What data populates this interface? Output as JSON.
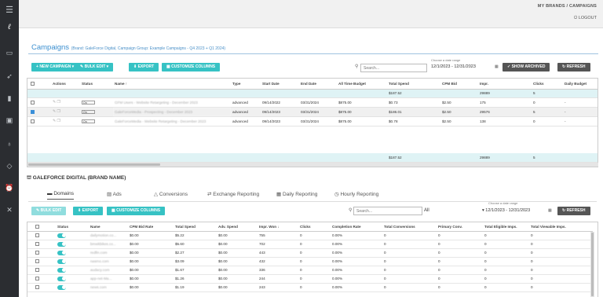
{
  "header": {
    "breadcrumb": "MY BRANDS / CAMPAIGNS",
    "logout": "LOGOUT"
  },
  "sidebar": {
    "icons": [
      "menu-icon",
      "logo-icon",
      "monitor-icon",
      "rocket-icon",
      "chart-icon",
      "briefcase-icon",
      "lightbulb-icon",
      "gem-icon",
      "alarm-icon",
      "tools-icon"
    ]
  },
  "campaigns": {
    "title": "Campaigns",
    "subtitle": "(Brand: GaleForce Digital, Campaign Group: Example Campaigns - Q4 2023 + Q1 2024)",
    "new_campaign": "NEW CAMPAIGN",
    "bulk_edit": "BULK EDIT",
    "export": "EXPORT",
    "customize": "CUSTOMIZE COLUMNS",
    "search_placeholder": "Search...",
    "date_label": "Choose a date range",
    "date_range": "12/1/2023 - 12/31/2023",
    "show_archived": "SHOW ARCHIVED",
    "refresh": "REFRESH",
    "columns": [
      "Actions",
      "Status",
      "Name ↑",
      "Type",
      "Start Date",
      "End Date",
      "All Time Budget",
      "Total Spend",
      "CPM Bid",
      "Impr.",
      "Clicks",
      "Daily Budget"
    ],
    "totals": {
      "spend": "$187.52",
      "impr": "29889",
      "clicks": "5"
    },
    "rows": [
      {
        "status": "On",
        "name": "GFM Users - Website Retargeting - December 2023",
        "type": "advanced",
        "start": "09/14/2022",
        "end": "03/31/2024",
        "budget": "$875.00",
        "spend": "$0.73",
        "cpm": "$2.50",
        "impr": "175",
        "clicks": "0",
        "daily": "-"
      },
      {
        "status": "On",
        "name": "GaleForceMedia - Prospecting - December 2023",
        "type": "advanced",
        "start": "09/14/2023",
        "end": "03/31/2024",
        "budget": "$875.00",
        "spend": "$186.01",
        "cpm": "$2.50",
        "impr": "29576",
        "clicks": "5",
        "daily": "-"
      },
      {
        "status": "On",
        "name": "GaleForceMedia - Website Retargeting - December 2023",
        "type": "advanced",
        "start": "09/14/2023",
        "end": "03/31/2024",
        "budget": "$875.00",
        "spend": "$0.78",
        "cpm": "$2.50",
        "impr": "138",
        "clicks": "0",
        "daily": "-"
      }
    ]
  },
  "brand_section": {
    "title": "GALEFORCE DIGITAL (BRAND NAME)",
    "tabs": [
      "Domains",
      "Ads",
      "Conversions",
      "Exchange Reporting",
      "Daily Reporting",
      "Hourly Reporting"
    ],
    "bulk_edit": "BULK EDIT",
    "export": "EXPORT",
    "customize": "CUSTOMIZE COLUMNS",
    "search_placeholder": "Search...",
    "filter": "All",
    "date_label": "Choose a date range",
    "date_range": "12/1/2023 - 12/31/2023",
    "refresh": "REFRESH",
    "columns": [
      "Status",
      "Name",
      "CPM Bid Rate",
      "Total Spend",
      "Adv. Spend",
      "Impr. Won ↓",
      "Clicks",
      "Completion Rate",
      "Total Conversions",
      "Primary Conv.",
      "Total Eligible Imps.",
      "Total Viewable Imps."
    ],
    "rows": [
      {
        "name": "dailymotion.co...",
        "cpm": "$0.00",
        "spend": "$5.22",
        "adv": "$0.00",
        "impr": "755",
        "clicks": "0",
        "comp": "0.00%",
        "conv": "0",
        "prim": "0",
        "elig": "0",
        "view": "0"
      },
      {
        "name": "bmwkbikes.co...",
        "cpm": "$0.00",
        "spend": "$5.60",
        "adv": "$0.00",
        "impr": "702",
        "clicks": "0",
        "comp": "0.00%",
        "conv": "0",
        "prim": "0",
        "elig": "0",
        "view": "0"
      },
      {
        "name": "redfin.com",
        "cpm": "$0.00",
        "spend": "$2.27",
        "adv": "$0.00",
        "impr": "443",
        "clicks": "0",
        "comp": "0.00%",
        "conv": "0",
        "prim": "0",
        "elig": "0",
        "view": "0"
      },
      {
        "name": "nasmo.com",
        "cpm": "$0.00",
        "spend": "$3.09",
        "adv": "$0.00",
        "impr": "432",
        "clicks": "0",
        "comp": "0.00%",
        "conv": "0",
        "prim": "0",
        "elig": "0",
        "view": "0"
      },
      {
        "name": "audacy.com",
        "cpm": "$0.00",
        "spend": "$1.67",
        "adv": "$0.00",
        "impr": "336",
        "clicks": "0",
        "comp": "0.00%",
        "conv": "0",
        "prim": "0",
        "elig": "0",
        "view": "0"
      },
      {
        "name": "app-net-Ma...",
        "cpm": "$0.00",
        "spend": "$1.26",
        "adv": "$0.00",
        "impr": "244",
        "clicks": "0",
        "comp": "0.00%",
        "conv": "0",
        "prim": "0",
        "elig": "0",
        "view": "0"
      },
      {
        "name": "news.com",
        "cpm": "$0.00",
        "spend": "$1.19",
        "adv": "$0.00",
        "impr": "243",
        "clicks": "0",
        "comp": "0.00%",
        "conv": "0",
        "prim": "0",
        "elig": "0",
        "view": "0"
      }
    ]
  }
}
